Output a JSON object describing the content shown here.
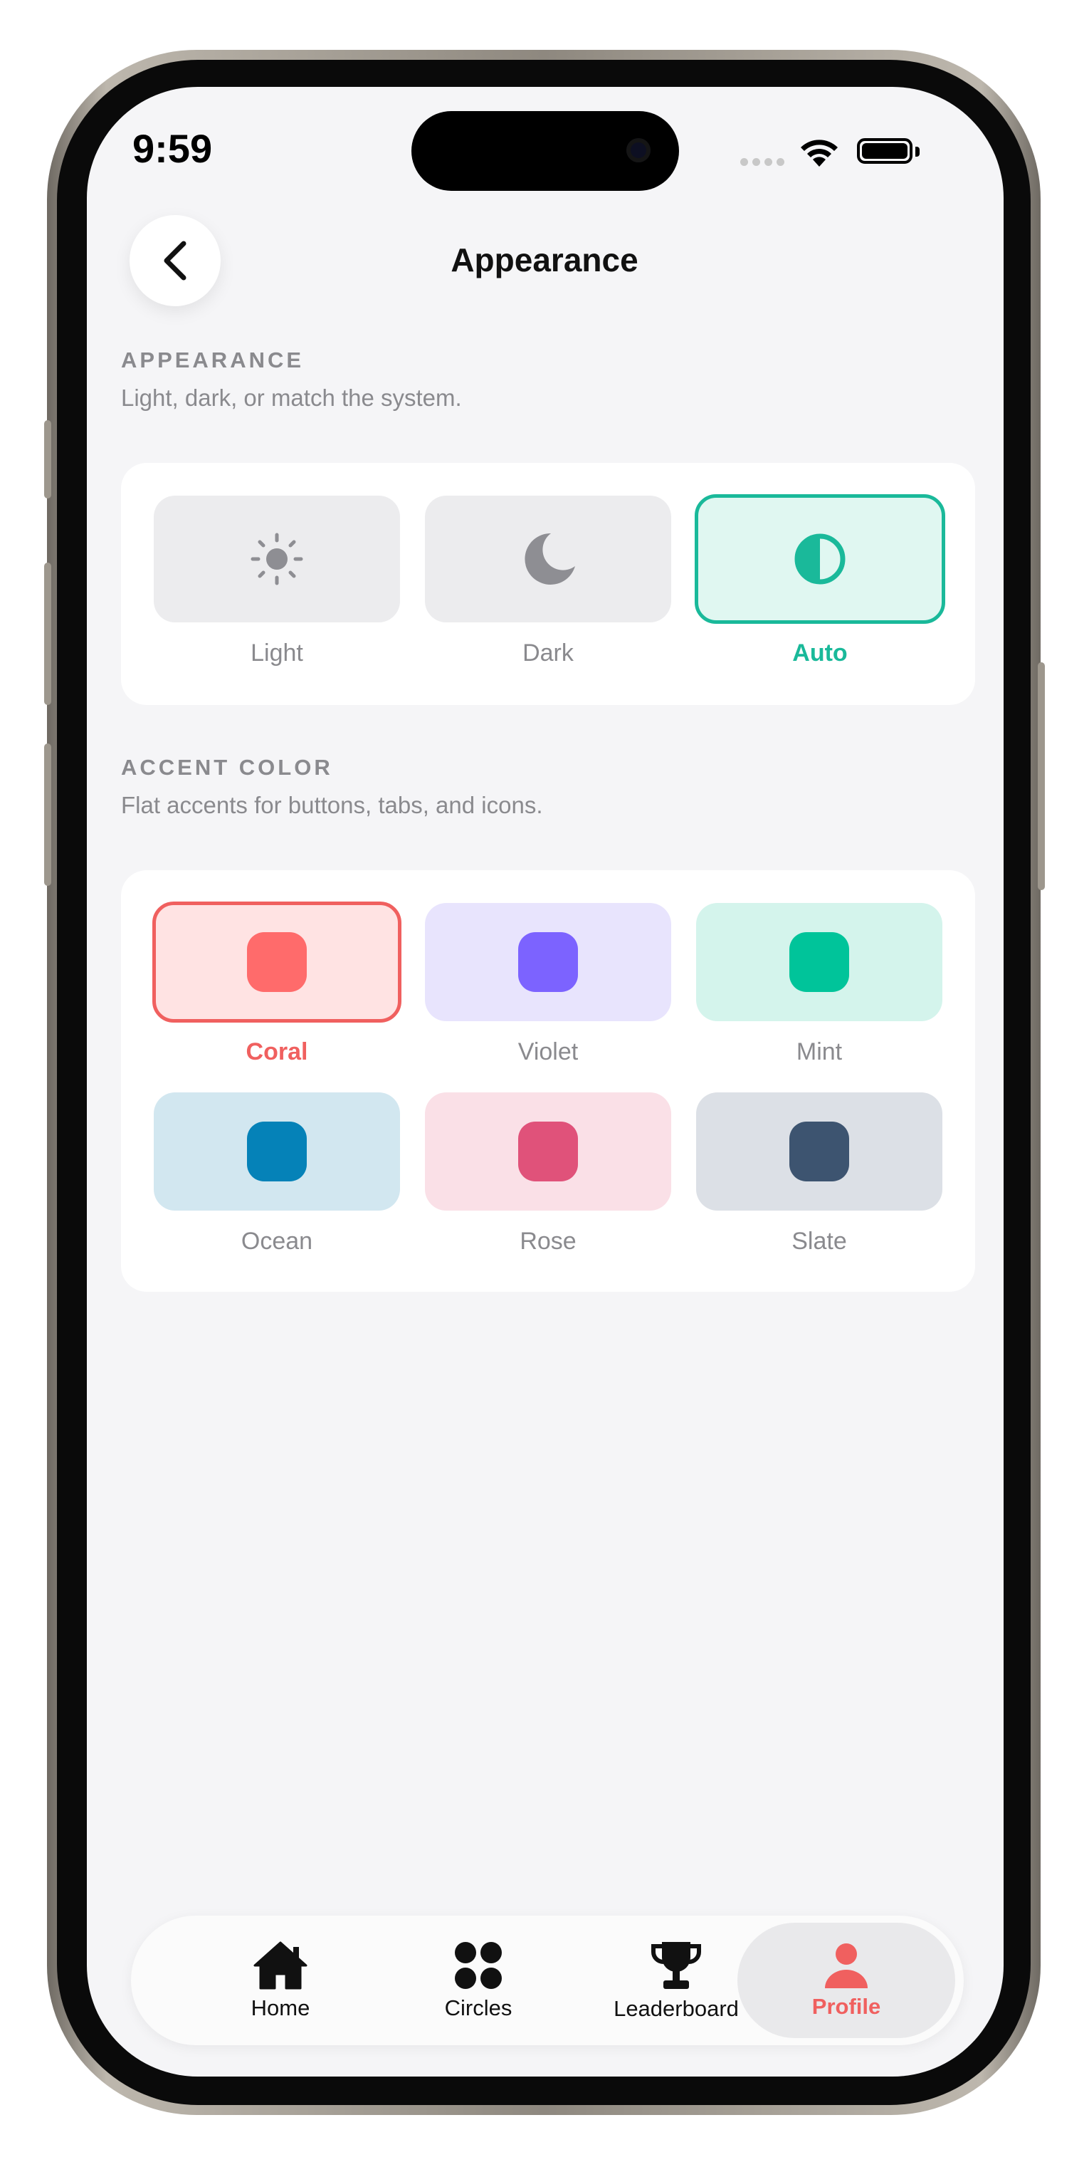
{
  "status_bar": {
    "time": "9:59"
  },
  "header": {
    "title": "Appearance"
  },
  "appearance": {
    "section_title": "APPEARANCE",
    "section_subtitle": "Light, dark, or match the system.",
    "options": [
      {
        "label": "Light",
        "icon": "sun-icon",
        "selected": false
      },
      {
        "label": "Dark",
        "icon": "moon-icon",
        "selected": false
      },
      {
        "label": "Auto",
        "icon": "half-circle-icon",
        "selected": true
      }
    ]
  },
  "accent": {
    "section_title": "ACCENT COLOR",
    "section_subtitle": "Flat accents for buttons, tabs, and icons.",
    "options": [
      {
        "label": "Coral",
        "color": "#ff6b6b",
        "tint": "#ffe3e3",
        "selected": true
      },
      {
        "label": "Violet",
        "color": "#7c63ff",
        "tint": "#e8e4fd",
        "selected": false
      },
      {
        "label": "Mint",
        "color": "#00c49a",
        "tint": "#d4f4ec",
        "selected": false
      },
      {
        "label": "Ocean",
        "color": "#0582b8",
        "tint": "#d2e7f0",
        "selected": false
      },
      {
        "label": "Rose",
        "color": "#e0527a",
        "tint": "#fae0e7",
        "selected": false
      },
      {
        "label": "Slate",
        "color": "#3d5470",
        "tint": "#dce0e6",
        "selected": false
      }
    ]
  },
  "tabs": [
    {
      "label": "Home",
      "icon": "house-icon",
      "active": false
    },
    {
      "label": "Circles",
      "icon": "four-dots-icon",
      "active": false
    },
    {
      "label": "Leaderboard",
      "icon": "trophy-icon",
      "active": false
    },
    {
      "label": "Profile",
      "icon": "person-icon",
      "active": true
    }
  ],
  "colors": {
    "auto_accent": "#1ab99a",
    "coral_accent": "#f0605f",
    "background": "#f5f5f7"
  }
}
